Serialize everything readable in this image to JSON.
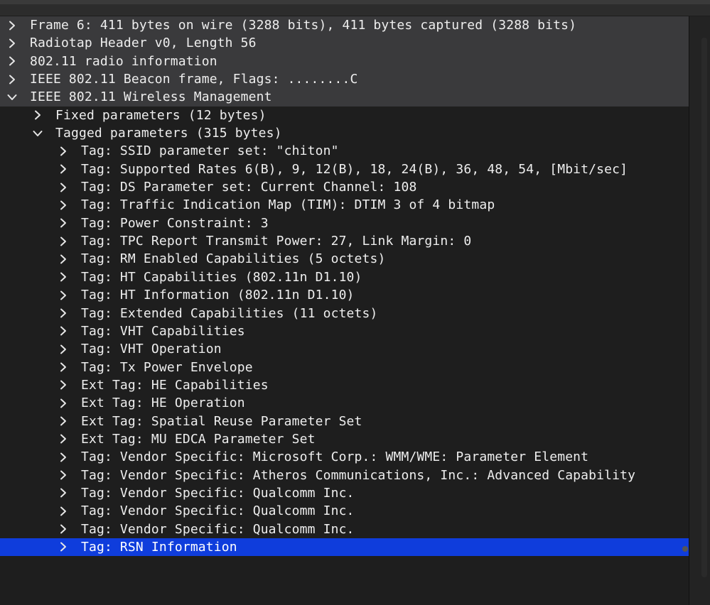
{
  "tree": [
    {
      "label": "Frame 6: 411 bytes on wire (3288 bits), 411 bytes captured (3288 bits)",
      "level": 0,
      "expanded": false
    },
    {
      "label": "Radiotap Header v0, Length 56",
      "level": 0,
      "expanded": false
    },
    {
      "label": "802.11 radio information",
      "level": 0,
      "expanded": false
    },
    {
      "label": "IEEE 802.11 Beacon frame, Flags: ........C",
      "level": 0,
      "expanded": false
    },
    {
      "label": "IEEE 802.11 Wireless Management",
      "level": 0,
      "expanded": true
    },
    {
      "label": "Fixed parameters (12 bytes)",
      "level": 1,
      "expanded": false
    },
    {
      "label": "Tagged parameters (315 bytes)",
      "level": 1,
      "expanded": true
    },
    {
      "label": "Tag: SSID parameter set: \"chiton\"",
      "level": 2,
      "expanded": false
    },
    {
      "label": "Tag: Supported Rates 6(B), 9, 12(B), 18, 24(B), 36, 48, 54, [Mbit/sec]",
      "level": 2,
      "expanded": false
    },
    {
      "label": "Tag: DS Parameter set: Current Channel: 108",
      "level": 2,
      "expanded": false
    },
    {
      "label": "Tag: Traffic Indication Map (TIM): DTIM 3 of 4 bitmap",
      "level": 2,
      "expanded": false
    },
    {
      "label": "Tag: Power Constraint: 3",
      "level": 2,
      "expanded": false
    },
    {
      "label": "Tag: TPC Report Transmit Power: 27, Link Margin: 0",
      "level": 2,
      "expanded": false
    },
    {
      "label": "Tag: RM Enabled Capabilities (5 octets)",
      "level": 2,
      "expanded": false
    },
    {
      "label": "Tag: HT Capabilities (802.11n D1.10)",
      "level": 2,
      "expanded": false
    },
    {
      "label": "Tag: HT Information (802.11n D1.10)",
      "level": 2,
      "expanded": false
    },
    {
      "label": "Tag: Extended Capabilities (11 octets)",
      "level": 2,
      "expanded": false
    },
    {
      "label": "Tag: VHT Capabilities",
      "level": 2,
      "expanded": false
    },
    {
      "label": "Tag: VHT Operation",
      "level": 2,
      "expanded": false
    },
    {
      "label": "Tag: Tx Power Envelope",
      "level": 2,
      "expanded": false
    },
    {
      "label": "Ext Tag: HE Capabilities",
      "level": 2,
      "expanded": false
    },
    {
      "label": "Ext Tag: HE Operation",
      "level": 2,
      "expanded": false
    },
    {
      "label": "Ext Tag: Spatial Reuse Parameter Set",
      "level": 2,
      "expanded": false
    },
    {
      "label": "Ext Tag: MU EDCA Parameter Set",
      "level": 2,
      "expanded": false
    },
    {
      "label": "Tag: Vendor Specific: Microsoft Corp.: WMM/WME: Parameter Element",
      "level": 2,
      "expanded": false
    },
    {
      "label": "Tag: Vendor Specific: Atheros Communications, Inc.: Advanced Capability",
      "level": 2,
      "expanded": false
    },
    {
      "label": "Tag: Vendor Specific: Qualcomm Inc.",
      "level": 2,
      "expanded": false
    },
    {
      "label": "Tag: Vendor Specific: Qualcomm Inc.",
      "level": 2,
      "expanded": false
    },
    {
      "label": "Tag: Vendor Specific: Qualcomm Inc.",
      "level": 2,
      "expanded": false
    },
    {
      "label": "Tag: RSN Information",
      "level": 2,
      "expanded": false,
      "selected": true
    }
  ],
  "icons": {
    "collapsed": "chevron-right-icon",
    "expanded": "chevron-down-icon"
  },
  "colors": {
    "background": "#1e1e1e",
    "top_level_row": "#3a3a3c",
    "selected_row": "#0f3ddc",
    "text": "#eeeeee"
  }
}
